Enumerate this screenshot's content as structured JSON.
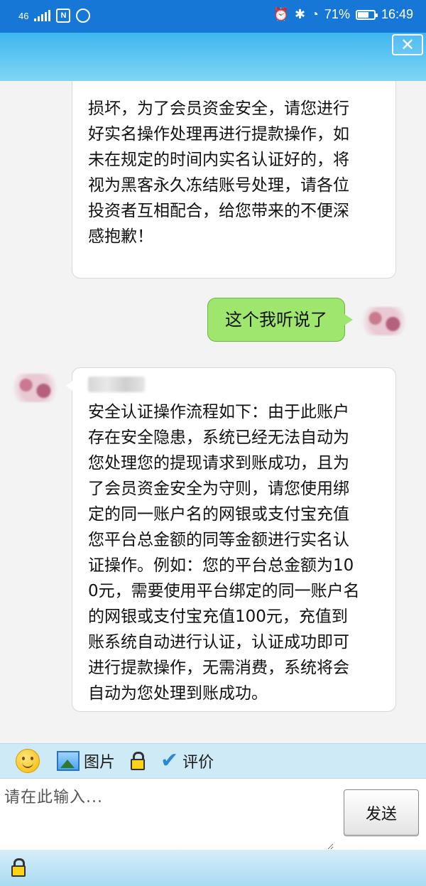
{
  "status_bar": {
    "network": "46",
    "battery": "71%",
    "battery_level": 0.71,
    "time": "16:49",
    "nfc_label": "N"
  },
  "header": {
    "close_glyph": "✕"
  },
  "messages": [
    {
      "from": "agent",
      "lines": [
        "损坏，为了会员资金安全，请您进行",
        "好实名操作处理再进行提款操作，如",
        "未在规定的时间内实名认证好的，将",
        "视为黑客永久冻结账号处理，请各位",
        "投资者互相配合，给您带来的不便深",
        "感抱歉！"
      ]
    },
    {
      "from": "me",
      "text": "这个我听说了"
    },
    {
      "from": "agent",
      "lines": [
        "安全认证操作流程如下：由于此账户",
        "存在安全隐患，系统已经无法自动为",
        "您处理您的提现请求到账成功，且为",
        "了会员资金安全为守则，请您使用绑",
        "定的同一账户名的网银或支付宝充值",
        "您平台总金额的同等金额进行实名认",
        "证操作。例如：您的平台总金额为10",
        "0元，需要使用平台绑定的同一账户名",
        "的网银或支付宝充值100元，充值到",
        "账系统自动进行认证，认证成功即可",
        "进行提款操作，无需消费，系统将会",
        "自动为您处理到账成功。"
      ]
    }
  ],
  "toolbar": {
    "emoji_icon": "smiley-icon",
    "picture_label": "图片",
    "rate_label": "评价"
  },
  "composer": {
    "placeholder": "请在此输入...",
    "send_label": "发送"
  },
  "colors": {
    "status_bar": "#1677d6",
    "header": "#3fb6ef",
    "sent_bubble": "#9ee66d",
    "toolbar": "#cfeaf7"
  }
}
